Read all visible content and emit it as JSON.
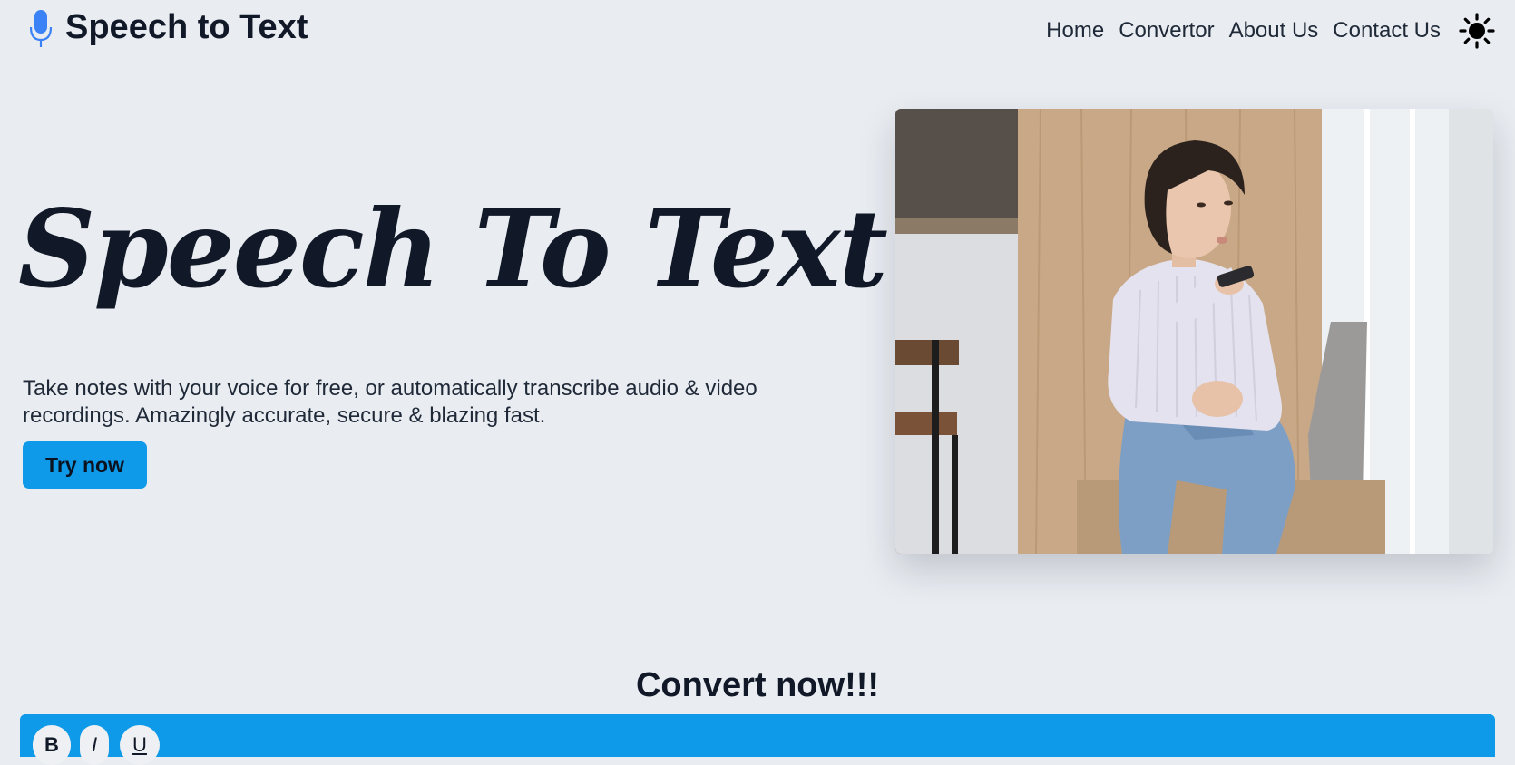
{
  "header": {
    "brand_title": "Speech to Text",
    "nav": [
      {
        "label": "Home"
      },
      {
        "label": "Convertor"
      },
      {
        "label": "About Us"
      },
      {
        "label": "Contact Us"
      }
    ],
    "theme_icon": "sun-icon",
    "brand_icon": "microphone-icon"
  },
  "hero": {
    "title": "Speech To Text",
    "description": "Take notes with your voice for free, or automatically transcribe audio & video recordings. Amazingly accurate, secure & blazing fast.",
    "cta_label": "Try now",
    "image": "woman-speaking-into-phone-photo"
  },
  "converter": {
    "heading": "Convert now!!!",
    "toolbar": {
      "bold_label": "B",
      "italic_label": "I",
      "underline_label": "U"
    }
  },
  "colors": {
    "background": "#e9edf2",
    "accent": "#0e9ae8",
    "text": "#111827",
    "mic_icon": "#3b82f6"
  }
}
